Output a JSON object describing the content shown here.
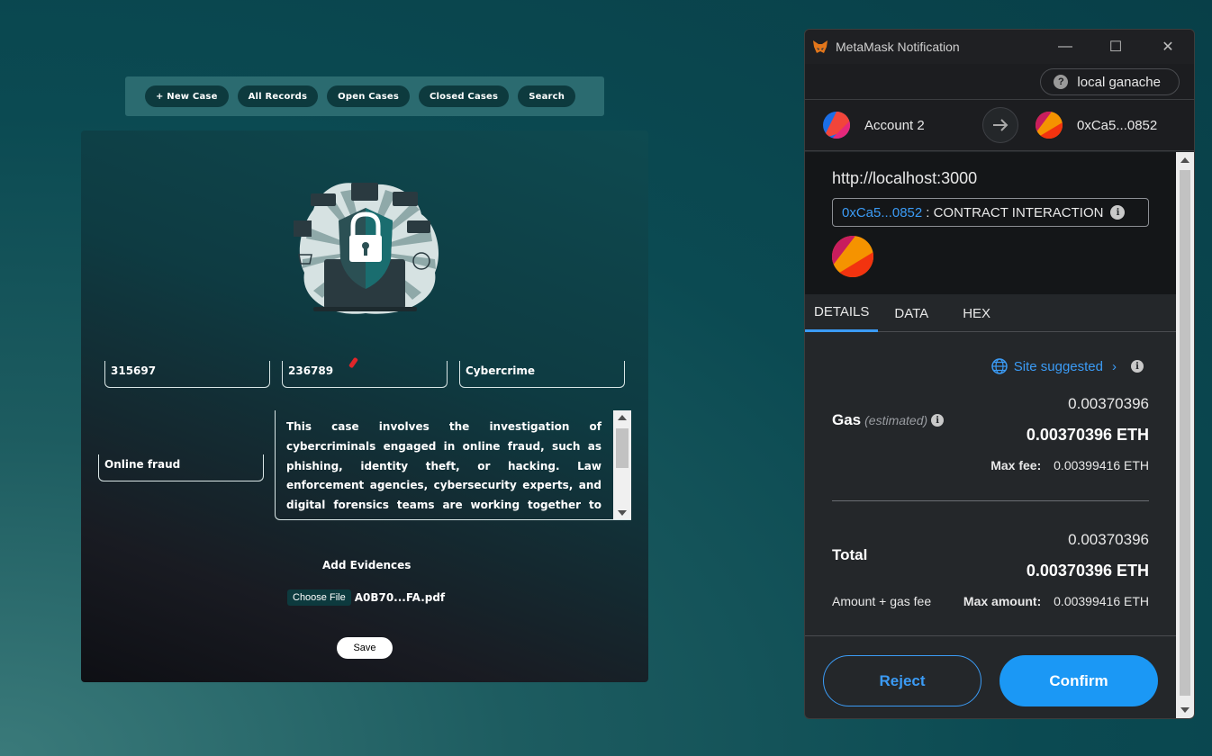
{
  "nav": {
    "buttons": [
      "+ New Case",
      "All Records",
      "Open Cases",
      "Closed Cases",
      "Search"
    ]
  },
  "form": {
    "case_id": "315697",
    "second_id": "236789",
    "category": "Cybercrime",
    "subcategory": "Online fraud",
    "description": "This case involves the investigation of cybercriminals engaged in online fraud, such as phishing, identity theft, or hacking. Law enforcement agencies, cybersecurity experts, and digital forensics teams are working together to track down the perpetrators and bring them to justice.",
    "evidence_label": "Add Evidences",
    "choose_file_label": "Choose File",
    "file_name": "A0B70...FA.pdf",
    "save_label": "Save"
  },
  "metamask": {
    "window_title": "MetaMask Notification",
    "network": "local ganache",
    "from_account": "Account 2",
    "to_account": "0xCa5...0852",
    "origin": "http://localhost:3000",
    "contract_address": "0xCa5...0852",
    "contract_label": ": CONTRACT INTERACTION",
    "tabs": [
      "DETAILS",
      "DATA",
      "HEX"
    ],
    "site_suggested": "Site suggested",
    "gas_label": "Gas",
    "gas_estimated": "(estimated)",
    "gas_value": "0.00370396",
    "gas_eth": "0.00370396 ETH",
    "max_fee_label": "Max fee:",
    "max_fee_value": "0.00399416 ETH",
    "total_label": "Total",
    "total_value": "0.00370396",
    "total_eth": "0.00370396 ETH",
    "amount_gas_label": "Amount + gas fee",
    "max_amount_label": "Max amount:",
    "max_amount_value": "0.00399416 ETH",
    "reject_label": "Reject",
    "confirm_label": "Confirm"
  },
  "colors": {
    "accent_blue": "#1b98f5",
    "link_blue": "#3b9bf5",
    "nav_button": "#0d3a3e"
  }
}
